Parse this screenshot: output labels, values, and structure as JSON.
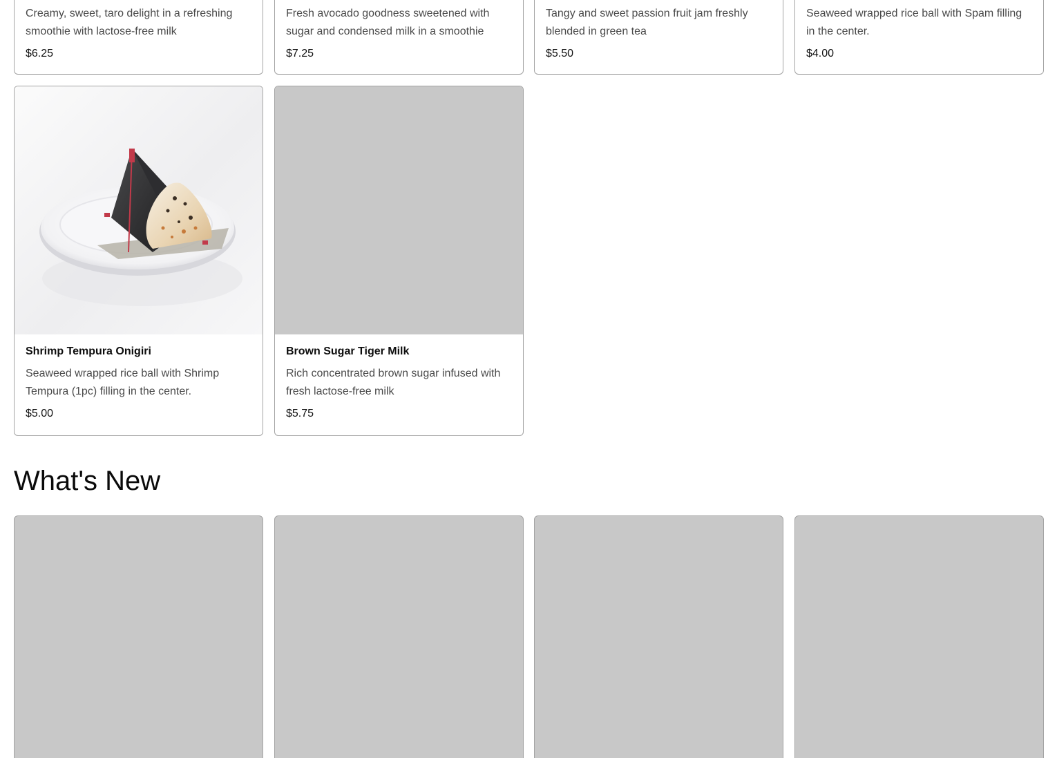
{
  "top_row": [
    {
      "description": "Creamy, sweet, taro delight in a refreshing smoothie with lactose-free milk",
      "price": "$6.25"
    },
    {
      "description": "Fresh avocado goodness sweetened with sugar and condensed milk in a smoothie",
      "price": "$7.25"
    },
    {
      "description": "Tangy and sweet passion fruit jam freshly blended in green tea",
      "price": "$5.50"
    },
    {
      "description": "Seaweed wrapped rice ball with Spam filling in the center.",
      "price": "$4.00"
    }
  ],
  "second_row": [
    {
      "name": "Shrimp Tempura Onigiri",
      "description": "Seaweed wrapped rice ball with Shrimp Tempura (1pc) filling in the center.",
      "price": "$5.00",
      "image": "onigiri-photo"
    },
    {
      "name": "Brown Sugar Tiger Milk",
      "description": "Rich concentrated brown sugar infused with fresh lactose-free milk",
      "price": "$5.75",
      "image": "image-placeholder"
    }
  ],
  "whats_new": {
    "title": "What's New",
    "card_count": 4
  },
  "colors": {
    "placeholder": "#c8c8c8",
    "border": "#a3a3a3",
    "description_text": "#4a4a4a"
  }
}
